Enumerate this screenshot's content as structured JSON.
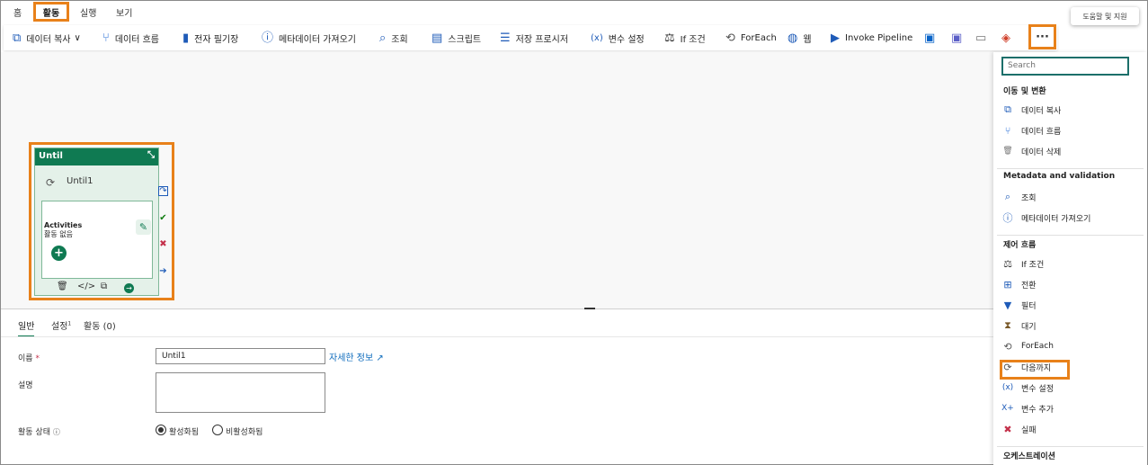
{
  "tabs": [
    "홈",
    "활동",
    "실행",
    "보기"
  ],
  "tooltip": "도움말 및 지원",
  "toolbar": [
    {
      "icon": "copy-data-icon",
      "glyph": "⧉",
      "color": "#1e5bb8",
      "label": "데이터 복사",
      "chevron": "∨"
    },
    {
      "icon": "dataflow-icon",
      "glyph": "⑂",
      "color": "#2a6fd6",
      "label": "데이터 흐름"
    },
    {
      "icon": "notebook-icon",
      "glyph": "▮",
      "color": "#1e5bb8",
      "label": "전자 필기장"
    },
    {
      "icon": "info-icon",
      "glyph": "ⓘ",
      "color": "#1e5bb8",
      "label": "메타데이터 가져오기"
    },
    {
      "icon": "lookup-icon",
      "glyph": "⌕",
      "color": "#1e5bb8",
      "label": "조회"
    },
    {
      "icon": "script-icon",
      "glyph": "▤",
      "color": "#1e5bb8",
      "label": "스크립트"
    },
    {
      "icon": "stored-procedure-icon",
      "glyph": "☰",
      "color": "#1e5bb8",
      "label": "저장 프로시저"
    },
    {
      "icon": "set-variable-icon",
      "glyph": "(x)",
      "color": "#1e5bb8",
      "label": "변수 설정"
    },
    {
      "icon": "if-condition-icon",
      "glyph": "⚖",
      "color": "#333333",
      "label": "If 조건"
    },
    {
      "icon": "foreach-icon",
      "glyph": "⟲",
      "color": "#555555",
      "label": "ForEach"
    },
    {
      "icon": "web-icon",
      "glyph": "◍",
      "color": "#1e5bb8",
      "label": "웹"
    },
    {
      "icon": "invoke-pipeline-icon",
      "glyph": "▶",
      "color": "#1e5bb8",
      "label": "Invoke Pipeline"
    },
    {
      "icon": "outlook-icon",
      "glyph": "▣",
      "color": "#0a64c8",
      "label": ""
    },
    {
      "icon": "teams-icon",
      "glyph": "▣",
      "color": "#5b5fc7",
      "label": ""
    },
    {
      "icon": "form-icon",
      "glyph": "▭",
      "color": "#777777",
      "label": ""
    },
    {
      "icon": "layers-icon",
      "glyph": "◈",
      "color": "#d0402b",
      "label": ""
    }
  ],
  "more_label": "···",
  "until_card": {
    "header": "Until",
    "name": "Until1",
    "activities_title": "Activities",
    "activities_empty": "활동 없음"
  },
  "props": {
    "tabs": [
      {
        "label": "일반",
        "sup": ""
      },
      {
        "label": "설정",
        "sup": "1"
      },
      {
        "label": "활동 (0)",
        "sup": ""
      }
    ],
    "name_label": "이름",
    "required_mark": "*",
    "name_value": "Until1",
    "learn_more": "자세한 정보",
    "learn_more_icon": "↗",
    "description_label": "설명",
    "state_label": "활동 상태",
    "state_info": "ⓘ",
    "radio_active": "활성화됨",
    "radio_inactive": "비활성화됨"
  },
  "pane": {
    "search_placeholder": "Search",
    "sections": [
      {
        "title": "이동 및 변환",
        "items": [
          {
            "icon": "copy-data-icon",
            "glyph": "⧉",
            "color": "#1e5bb8",
            "label": "데이터 복사"
          },
          {
            "icon": "dataflow-icon",
            "glyph": "⑂",
            "color": "#2a6fd6",
            "label": "데이터 흐름"
          },
          {
            "icon": "delete-icon",
            "glyph": "🗑",
            "color": "#777777",
            "label": "데이터 삭제"
          }
        ]
      },
      {
        "title": "Metadata and validation",
        "items": [
          {
            "icon": "lookup-icon",
            "glyph": "⌕",
            "color": "#1e5bb8",
            "label": "조회"
          },
          {
            "icon": "info-icon",
            "glyph": "ⓘ",
            "color": "#1e5bb8",
            "label": "메타데이터 가져오기"
          }
        ]
      },
      {
        "title": "제어 흐름",
        "items": [
          {
            "icon": "if-condition-icon",
            "glyph": "⚖",
            "color": "#333333",
            "label": "If 조건"
          },
          {
            "icon": "switch-icon",
            "glyph": "⊞",
            "color": "#1e5bb8",
            "label": "전환"
          },
          {
            "icon": "filter-icon",
            "glyph": "▼",
            "color": "#1e5bb8",
            "label": "필터"
          },
          {
            "icon": "wait-icon",
            "glyph": "⧗",
            "color": "#7a5a2a",
            "label": "대기"
          },
          {
            "icon": "foreach-icon",
            "glyph": "⟲",
            "color": "#555555",
            "label": "ForEach"
          },
          {
            "icon": "until-icon",
            "glyph": "⟳",
            "color": "#555555",
            "label": "다음까지"
          },
          {
            "icon": "set-variable-icon",
            "glyph": "(x)",
            "color": "#1e5bb8",
            "label": "변수 설정"
          },
          {
            "icon": "append-variable-icon",
            "glyph": "X+",
            "color": "#1e5bb8",
            "label": "변수 추가"
          },
          {
            "icon": "fail-icon",
            "glyph": "✖",
            "color": "#c4314b",
            "label": "실패"
          }
        ]
      },
      {
        "title": "오케스트레이션",
        "items": []
      }
    ]
  }
}
